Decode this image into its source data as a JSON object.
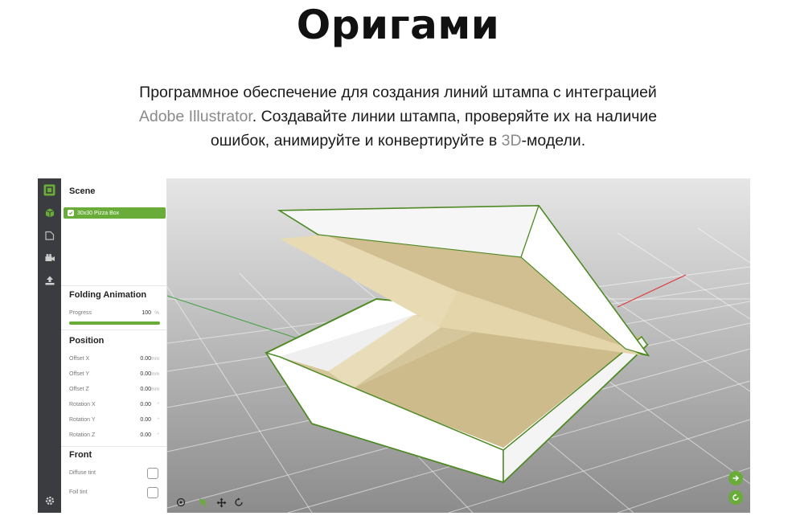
{
  "hero": {
    "title": "Оригами",
    "subtitle_part1": "Программное обеспечение для создания линий штампа с интеграцией ",
    "subtitle_adobe": "Adobe Illustrator",
    "subtitle_part2": ". Создавайте линии штампа, проверяйте их на наличие ошибок, анимируйте и конвертируйте в ",
    "subtitle_3d": "3D",
    "subtitle_part3": "-модели."
  },
  "panel": {
    "scene_title": "Scene",
    "scene_item": "30x30 Pizza Box",
    "folding_title": "Folding Animation",
    "progress_label": "Progress",
    "progress_value": "100",
    "progress_unit": "%",
    "progress_fraction": 1.0,
    "position_title": "Position",
    "position_rows": [
      {
        "label": "Offset X",
        "value": "0.00",
        "unit": "mm"
      },
      {
        "label": "Offset Y",
        "value": "0.00",
        "unit": "mm"
      },
      {
        "label": "Offset Z",
        "value": "0.00",
        "unit": "mm"
      },
      {
        "label": "Rotation X",
        "value": "0.00",
        "unit": "°"
      },
      {
        "label": "Rotation Y",
        "value": "0.00",
        "unit": "°"
      },
      {
        "label": "Rotation Z",
        "value": "0.00",
        "unit": "°"
      }
    ],
    "front_title": "Front",
    "diffuse_label": "Diffuse tint",
    "foil_label": "Foil tint"
  },
  "colors": {
    "accent": "#6aac3a",
    "iconbar": "#3b3c3f",
    "box_white": "#ffffff",
    "box_inner": "#d8c89c"
  },
  "icons": [
    "app-logo-icon",
    "box-icon",
    "folder-icon",
    "camera-icon",
    "export-icon",
    "settings-icon",
    "focus-icon",
    "select-arrow-icon",
    "move-icon",
    "rotate-icon",
    "next-icon",
    "refresh-icon"
  ]
}
